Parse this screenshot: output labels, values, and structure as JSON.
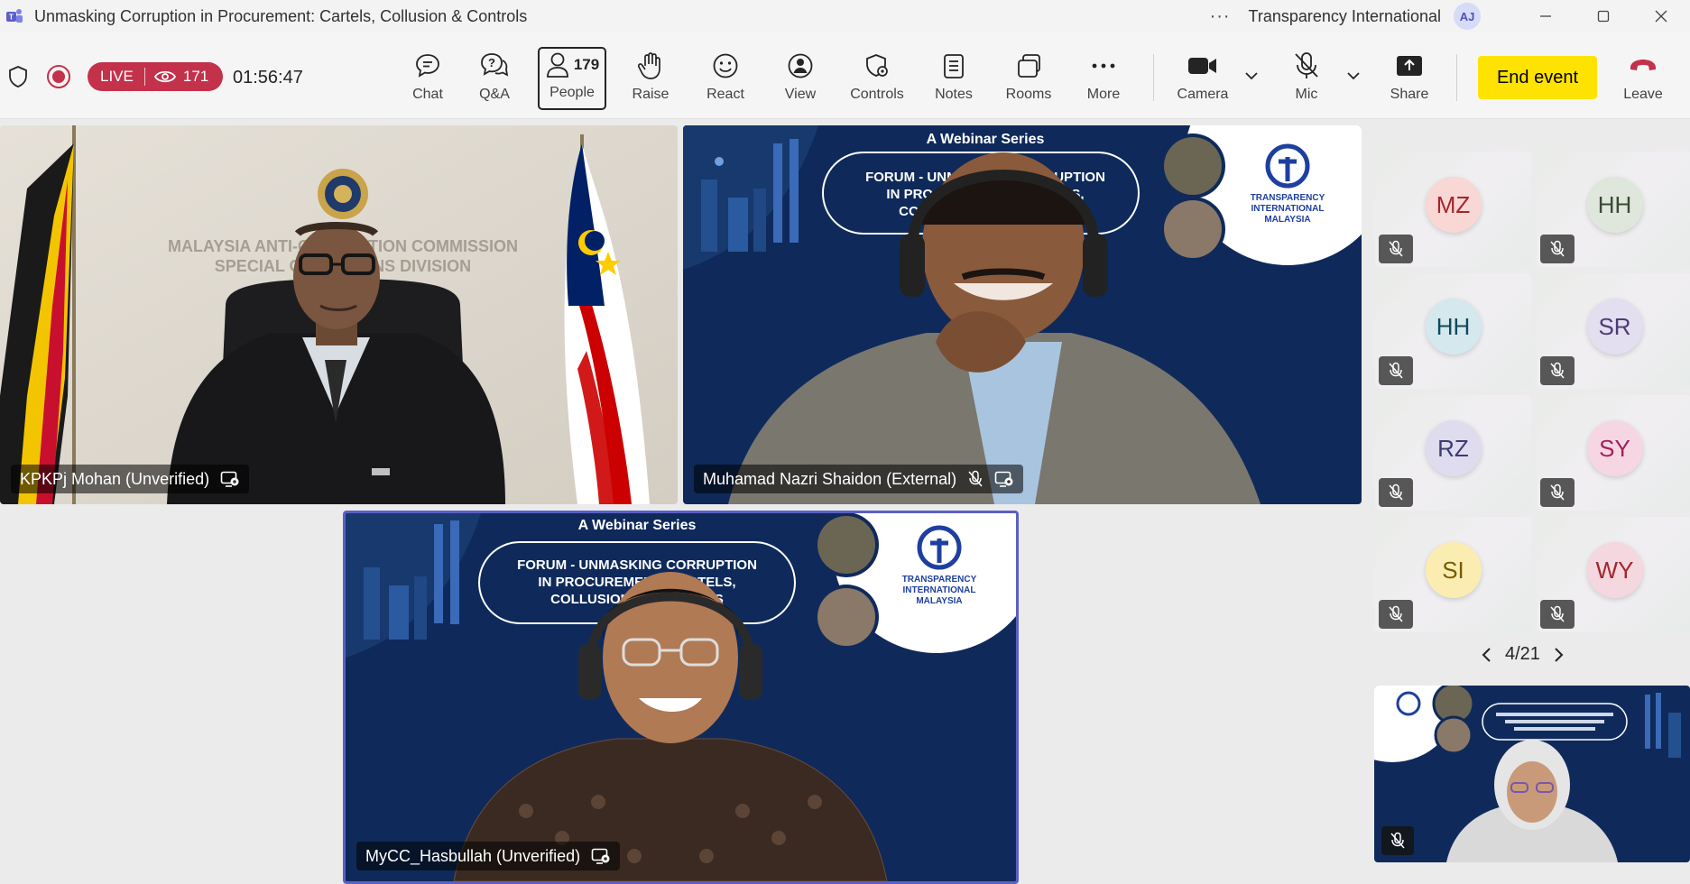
{
  "window": {
    "title": "Unmasking Corruption in Procurement: Cartels, Collusion & Controls",
    "org": "Transparency International",
    "user_initials": "AJ",
    "more_dots": "···"
  },
  "status": {
    "live_label": "LIVE",
    "viewer_count": "171",
    "timer": "01:56:47"
  },
  "toolbar": {
    "chat": "Chat",
    "qa": "Q&A",
    "people": "People",
    "people_count": "179",
    "raise": "Raise",
    "react": "React",
    "view": "View",
    "controls": "Controls",
    "notes": "Notes",
    "rooms": "Rooms",
    "more": "More",
    "camera": "Camera",
    "mic": "Mic",
    "share": "Share",
    "end_event": "End event",
    "leave": "Leave"
  },
  "tiles": {
    "t1_name": "KPKPj Mohan (Unverified)",
    "t1_wall_line1": "MALAYSIA ANTI-CORRUPTION COMMISSION",
    "t1_wall_line2": "SPECIAL OPERATIONS DIVISION",
    "t2_name": "Muhamad Nazri Shaidon (External)",
    "t3_name": "MyCC_Hasbullah (Unverified)",
    "banner_series": "A Webinar Series",
    "banner_line1": "FORUM - UNMASKING CORRUPTION",
    "banner_line2": "IN PROCUREMENT: CARTELS,",
    "banner_line3": "COLLUSION & CONTROLS",
    "ti_line1": "TRANSPARENCY",
    "ti_line2": "INTERNATIONAL",
    "ti_line3": "MALAYSIA"
  },
  "participants": [
    {
      "initials": "MZ",
      "bg": "#f8d7d5",
      "fg": "#a4262c"
    },
    {
      "initials": "HH",
      "bg": "#dfe6dc",
      "fg": "#3a4a36"
    },
    {
      "initials": "HH",
      "bg": "#d5e8ee",
      "fg": "#0e4a5c"
    },
    {
      "initials": "SR",
      "bg": "#e3def0",
      "fg": "#4a3d73"
    },
    {
      "initials": "RZ",
      "bg": "#dfdcef",
      "fg": "#3d3a73"
    },
    {
      "initials": "SY",
      "bg": "#f7d6e3",
      "fg": "#a0215b"
    },
    {
      "initials": "SI",
      "bg": "#fbedb2",
      "fg": "#7a5a00"
    },
    {
      "initials": "WY",
      "bg": "#f5d7e0",
      "fg": "#a4262c"
    }
  ],
  "pager": {
    "label": "4/21"
  },
  "colors": {
    "live": "#c4314b",
    "end_event": "#ffe300",
    "accent": "#5b5fc7",
    "banner_navy": "#0f2a5a"
  }
}
